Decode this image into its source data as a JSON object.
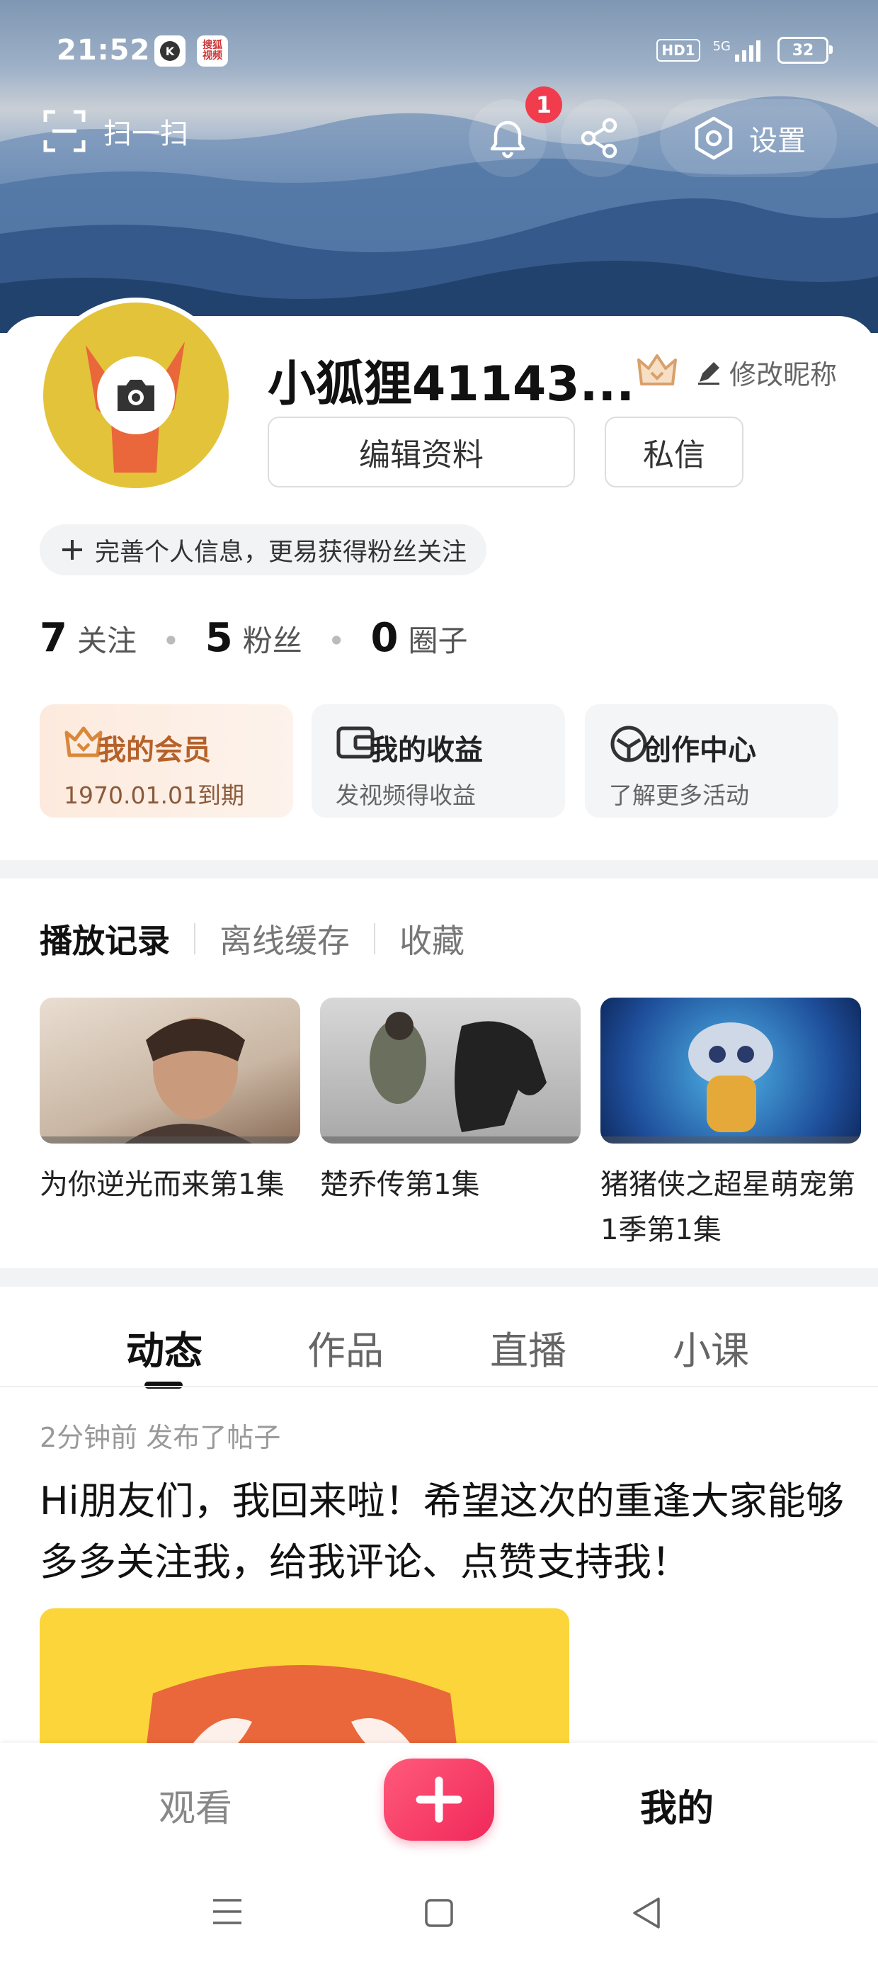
{
  "status_bar": {
    "time": "21:52",
    "app_icon_2_text": "搜狐\n视频",
    "hd_label": "HD1",
    "network": "5G",
    "battery": "32"
  },
  "top_bar": {
    "scan_label": "扫一扫",
    "notification_count": "1",
    "settings_label": "设置"
  },
  "profile": {
    "nickname": "小狐狸41143...",
    "edit_nickname_label": "修改昵称",
    "edit_profile_button": "编辑资料",
    "message_button": "私信",
    "hint_text": "完善个人信息，更易获得粉丝关注"
  },
  "stats": [
    {
      "count": "7",
      "label": "关注"
    },
    {
      "count": "5",
      "label": "粉丝"
    },
    {
      "count": "0",
      "label": "圈子"
    }
  ],
  "features": [
    {
      "title": "我的会员",
      "subtitle": "1970.01.01到期",
      "icon": "crown-icon"
    },
    {
      "title": "我的收益",
      "subtitle": "发视频得收益",
      "icon": "wallet-icon"
    },
    {
      "title": "创作中心",
      "subtitle": "了解更多活动",
      "icon": "creation-icon"
    }
  ],
  "history_tabs": [
    "播放记录",
    "离线缓存",
    "收藏"
  ],
  "history_items": [
    {
      "title": "为你逆光而来第1集"
    },
    {
      "title": "楚乔传第1集"
    },
    {
      "title": "猪猪侠之超星萌宠第1季第1集"
    }
  ],
  "main_tabs": [
    "动态",
    "作品",
    "直播",
    "小课"
  ],
  "post": {
    "meta": "2分钟前 发布了帖子",
    "text": "Hi朋友们，我回来啦！希望这次的重逢大家能够多多关注我，给我评论、点赞支持我！"
  },
  "bottom_nav": {
    "watch": "观看",
    "mine": "我的"
  },
  "colors": {
    "accent": "#f0285a",
    "vip_gold": "#d9883b",
    "badge_red": "#f03c4c"
  }
}
